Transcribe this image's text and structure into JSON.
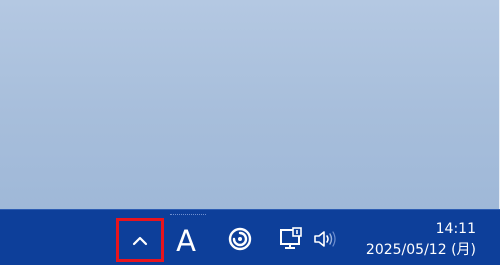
{
  "taskbar": {
    "background_color": "#0d3f9a",
    "highlight_color": "#e8141e",
    "tray": {
      "overflow_icon": "chevron-up-icon",
      "ime_label": "A",
      "icons": [
        "chevron-up-icon",
        "ime-indicator",
        "clock-app-icon",
        "network-icon",
        "volume-icon"
      ]
    },
    "clock": {
      "time": "14:11",
      "date": "2025/05/12 (月)"
    }
  }
}
